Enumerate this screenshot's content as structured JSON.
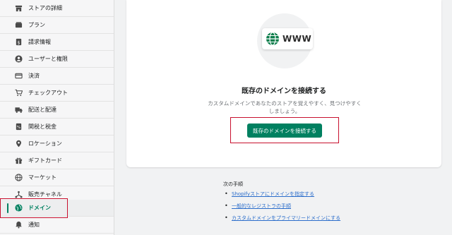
{
  "sidebar": {
    "items": [
      {
        "label": "ストアの詳細",
        "icon": "store-icon"
      },
      {
        "label": "プラン",
        "icon": "plan-icon"
      },
      {
        "label": "請求情報",
        "icon": "billing-icon"
      },
      {
        "label": "ユーザーと権限",
        "icon": "user-icon"
      },
      {
        "label": "決済",
        "icon": "payments-icon"
      },
      {
        "label": "チェックアウト",
        "icon": "cart-icon"
      },
      {
        "label": "配送と配達",
        "icon": "truck-icon"
      },
      {
        "label": "関税と税金",
        "icon": "tax-icon"
      },
      {
        "label": "ロケーション",
        "icon": "location-pin-icon"
      },
      {
        "label": "ギフトカード",
        "icon": "gift-icon"
      },
      {
        "label": "マーケット",
        "icon": "globe-icon"
      },
      {
        "label": "販売チャネル",
        "icon": "channels-icon"
      },
      {
        "label": "ドメイン",
        "icon": "domain-globe-icon",
        "active": true
      },
      {
        "label": "通知",
        "icon": "bell-icon"
      }
    ]
  },
  "main": {
    "badge_text": "WWW",
    "title": "既存のドメインを接続する",
    "description": "カスタムドメインであなたのストアを覚えやすく、見つけやすくしましょう。",
    "button_label": "既存のドメインを接続する"
  },
  "next_steps": {
    "title": "次の手順",
    "links": [
      "Shopifyストアにドメインを指定する",
      "一般的なレジストラの手順",
      "カスタムドメインをプライマリードメインにする"
    ]
  },
  "colors": {
    "accent": "#008060",
    "link": "#2c6ecb",
    "highlight": "#c8102e"
  }
}
